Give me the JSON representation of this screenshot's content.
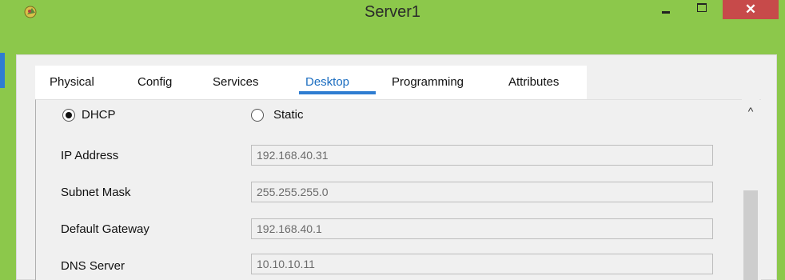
{
  "window": {
    "title": "Server1",
    "close_label": "✕",
    "accent_color": "#8cc84b",
    "close_color": "#c74a4a"
  },
  "tabs": [
    {
      "label": "Physical",
      "active": false
    },
    {
      "label": "Config",
      "active": false
    },
    {
      "label": "Services",
      "active": false
    },
    {
      "label": "Desktop",
      "active": true
    },
    {
      "label": "Programming",
      "active": false
    },
    {
      "label": "Attributes",
      "active": false
    }
  ],
  "ip_config": {
    "dhcp_label": "DHCP",
    "static_label": "Static",
    "selected": "DHCP",
    "fields": [
      {
        "label": "IP Address",
        "value": "192.168.40.31"
      },
      {
        "label": "Subnet Mask",
        "value": "255.255.255.0"
      },
      {
        "label": "Default Gateway",
        "value": "192.168.40.1"
      },
      {
        "label": "DNS Server",
        "value": "10.10.10.11"
      }
    ]
  },
  "scrollbar": {
    "up_arrow": "^"
  }
}
